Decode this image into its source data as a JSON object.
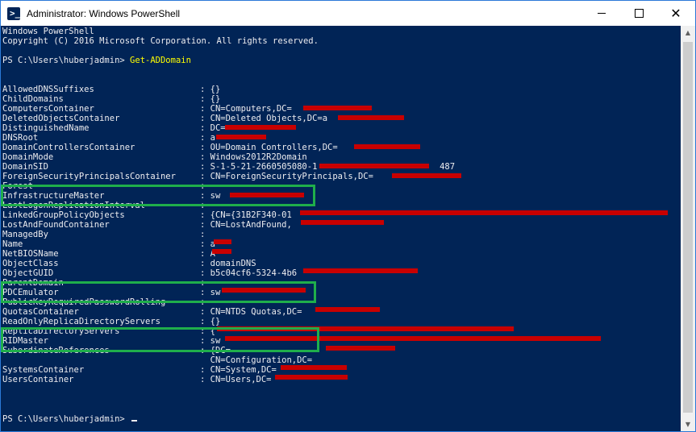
{
  "window": {
    "title": "Administrator: Windows PowerShell",
    "minimize_glyph": "",
    "close_glyph": "✕"
  },
  "console": {
    "banner": "Windows PowerShell",
    "copyright": "Copyright (C) 2016 Microsoft Corporation. All rights reserved.",
    "prompt": "PS C:\\Users\\huberjadmin> ",
    "command": "Get-ADDomain",
    "final_prompt": "PS C:\\Users\\huberjadmin> ",
    "properties": [
      {
        "name": "AllowedDNSSuffixes",
        "value": ": {}"
      },
      {
        "name": "ChildDomains",
        "value": ": {}"
      },
      {
        "name": "ComputersContainer",
        "value": ": CN=Computers,DC="
      },
      {
        "name": "DeletedObjectsContainer",
        "value": ": CN=Deleted Objects,DC=a"
      },
      {
        "name": "DistinguishedName",
        "value": ": DC="
      },
      {
        "name": "DNSRoot",
        "value": ": a"
      },
      {
        "name": "DomainControllersContainer",
        "value": ": OU=Domain Controllers,DC="
      },
      {
        "name": "DomainMode",
        "value": ": Windows2012R2Domain"
      },
      {
        "name": "DomainSID",
        "value": ": S-1-5-21-2660505080-1                        487"
      },
      {
        "name": "ForeignSecurityPrincipalsContainer",
        "value": ": CN=ForeignSecurityPrincipals,DC="
      },
      {
        "name": "Forest",
        "value": ":"
      },
      {
        "name": "InfrastructureMaster",
        "value": ": sw"
      },
      {
        "name": "LastLogonReplicationInterval",
        "value": ":"
      },
      {
        "name": "LinkedGroupPolicyObjects",
        "value": ": {CN={31B2F340-01"
      },
      {
        "name": "LostAndFoundContainer",
        "value": ": CN=LostAndFound,"
      },
      {
        "name": "ManagedBy",
        "value": ":"
      },
      {
        "name": "Name",
        "value": ": a"
      },
      {
        "name": "NetBIOSName",
        "value": ": A"
      },
      {
        "name": "ObjectClass",
        "value": ": domainDNS"
      },
      {
        "name": "ObjectGUID",
        "value": ": b5c04cf6-5324-4b6"
      },
      {
        "name": "ParentDomain",
        "value": ":"
      },
      {
        "name": "PDCEmulator",
        "value": ": sw"
      },
      {
        "name": "PublicKeyRequiredPasswordRolling",
        "value": ":"
      },
      {
        "name": "QuotasContainer",
        "value": ": CN=NTDS Quotas,DC="
      },
      {
        "name": "ReadOnlyReplicaDirectoryServers",
        "value": ": {}"
      },
      {
        "name": "ReplicaDirectoryServers",
        "value": ": {"
      },
      {
        "name": "RIDMaster",
        "value": ": sw"
      },
      {
        "name": "SubordinateReferences",
        "value": ": {DC="
      },
      {
        "name": "",
        "value": "  CN=Configuration,DC="
      },
      {
        "name": "SystemsContainer",
        "value": ": CN=System,DC="
      },
      {
        "name": "UsersContainer",
        "value": ": CN=Users,DC="
      }
    ]
  },
  "colors": {
    "console_bg": "#012456",
    "console_text": "#eeedf0",
    "command": "#ffff00",
    "highlight_box": "#1fae4b",
    "redaction": "#c80000"
  }
}
